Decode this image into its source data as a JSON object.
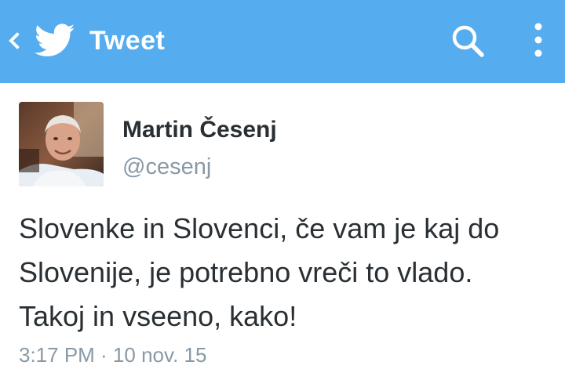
{
  "header": {
    "title": "Tweet",
    "back_icon": "chevron-left-icon",
    "logo_icon": "twitter-bird-icon",
    "search_icon": "search-icon",
    "menu_icon": "more-vert-icon",
    "background": "#55acee"
  },
  "tweet": {
    "author_name": "Martin Česenj",
    "author_handle": "@cesenj",
    "text_lines": [
      "Slovenke in Slovenci, če vam je kaj do",
      "Slovenije, je potrebno vreči to vlado.",
      "Takoj in vseeno, kako!"
    ],
    "timestamp": "3:17 PM · 10 nov. 15"
  }
}
